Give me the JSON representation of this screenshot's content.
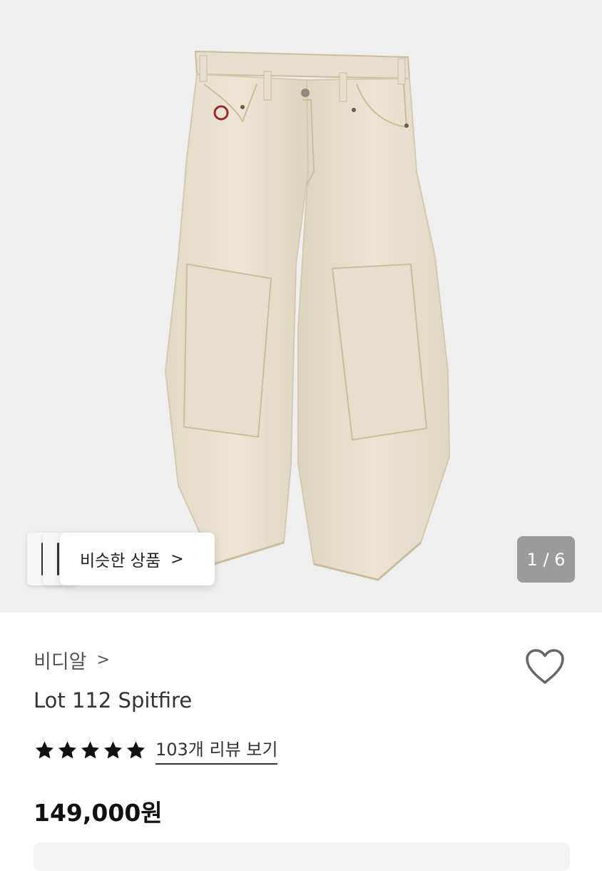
{
  "gallery": {
    "counter": "1 / 6",
    "similar_label": "비슷한 상품",
    "chevron": ">"
  },
  "product": {
    "brand": "비디알",
    "brand_chevron": ">",
    "name": "Lot 112 Spitfire",
    "rating": 5,
    "review_link": "103개 리뷰 보기",
    "price": "149,000원"
  },
  "colors": {
    "hero_bg": "#efefef",
    "pants": "#eae3d3",
    "pants_shadow": "#d9d0bc",
    "stitch": "#cbbd9c",
    "logo": "#9a2a2a",
    "counter_bg": "#8c8c8c",
    "star": "#111111"
  },
  "icons": {
    "wishlist": "heart-outline-icon",
    "star": "star-icon",
    "chevron": "chevron-right-icon"
  }
}
